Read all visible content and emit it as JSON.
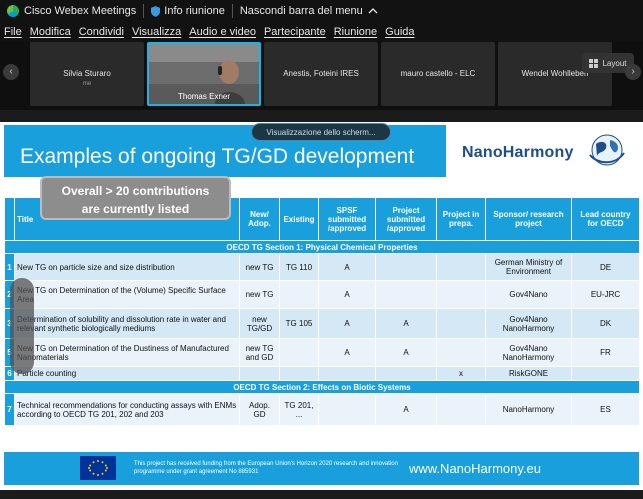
{
  "titlebar": {
    "app_name": "Cisco Webex Meetings",
    "meeting_info": "Info riunione",
    "hide_menu": "Nascondi barra del menu"
  },
  "menu": [
    "File",
    "Modifica",
    "Condividi",
    "Visualizza",
    "Audio e video",
    "Partecipante",
    "Riunione",
    "Guida"
  ],
  "participants": {
    "p1_name": "Silvia Sturaro",
    "p1_sub": "me",
    "p2_name": "Thomas Exner",
    "p3_name": "Anestis, Foteini IRES",
    "p4_name": "mauro castello - ELC",
    "p5_name": "Wendel Wohlleben",
    "layout_label": "Layout"
  },
  "share_view_label": "Visualizzazione dello scherm...",
  "slide": {
    "title": "Examples of ongoing TG/GD development",
    "logo_text": "NanoHarmony",
    "callout_line1": "Overall > 20 contributions",
    "callout_line2": "are currently listed",
    "headers": {
      "title": "Title",
      "new_adop": "New/ Adop.",
      "existing": "Existing",
      "spsf": "SPSF submitted /approved",
      "project": "Project submitted /approved",
      "prepa": "Project in prepa.",
      "sponsor": "Sponsor/ research project",
      "lead": "Lead country for OECD"
    },
    "section1": "OECD TG Section 1: Physical Chemical Properties",
    "section2": "OECD TG Section 2: Effects on Biotic Systems",
    "rows": [
      {
        "num": "1",
        "title": "New TG on particle size and size distribution",
        "new": "new TG",
        "existing": "TG 110",
        "spsf": "A",
        "project": "",
        "prepa": "",
        "sponsor": "German Ministry of Environment",
        "lead": "DE"
      },
      {
        "num": "2",
        "title": "New TG on Determination of the (Volume) Specific Surface Area",
        "new": "new TG",
        "existing": "",
        "spsf": "A",
        "project": "",
        "prepa": "",
        "sponsor": "Gov4Nano",
        "lead": "EU-JRC"
      },
      {
        "num": "3",
        "title": "Determination of solubility and dissolution rate in water and relevant synthetic biologically mediums",
        "new": "new TG/GD",
        "existing": "TG 105",
        "spsf": "A",
        "project": "A",
        "prepa": "",
        "sponsor": "Gov4Nano NanoHarmony",
        "lead": "DK"
      },
      {
        "num": "5",
        "title": "New TG on Determination of the Dustiness of Manufactured Nanomaterials",
        "new": "new TG and GD",
        "existing": "",
        "spsf": "A",
        "project": "A",
        "prepa": "",
        "sponsor": "Gov4Nano NanoHarmony",
        "lead": "FR"
      },
      {
        "num": "6",
        "title": "Particle counting",
        "new": "",
        "existing": "",
        "spsf": "",
        "project": "",
        "prepa": "x",
        "sponsor": "RiskGONE",
        "lead": ""
      },
      {
        "num": "7",
        "title": "Technical recommendations for conducting assays with ENMs according to OECD TG 201, 202 and 203",
        "new": "Adop. GD",
        "existing": "TG 201, ...",
        "spsf": "",
        "project": "A",
        "prepa": "",
        "sponsor": "NanoHarmony",
        "lead": "ES"
      }
    ],
    "footer_funding": "This project has received funding from the European Union's Horizon 2020 research and innovation programme under grant agreement No 885931",
    "footer_url": "www.NanoHarmony.eu"
  }
}
